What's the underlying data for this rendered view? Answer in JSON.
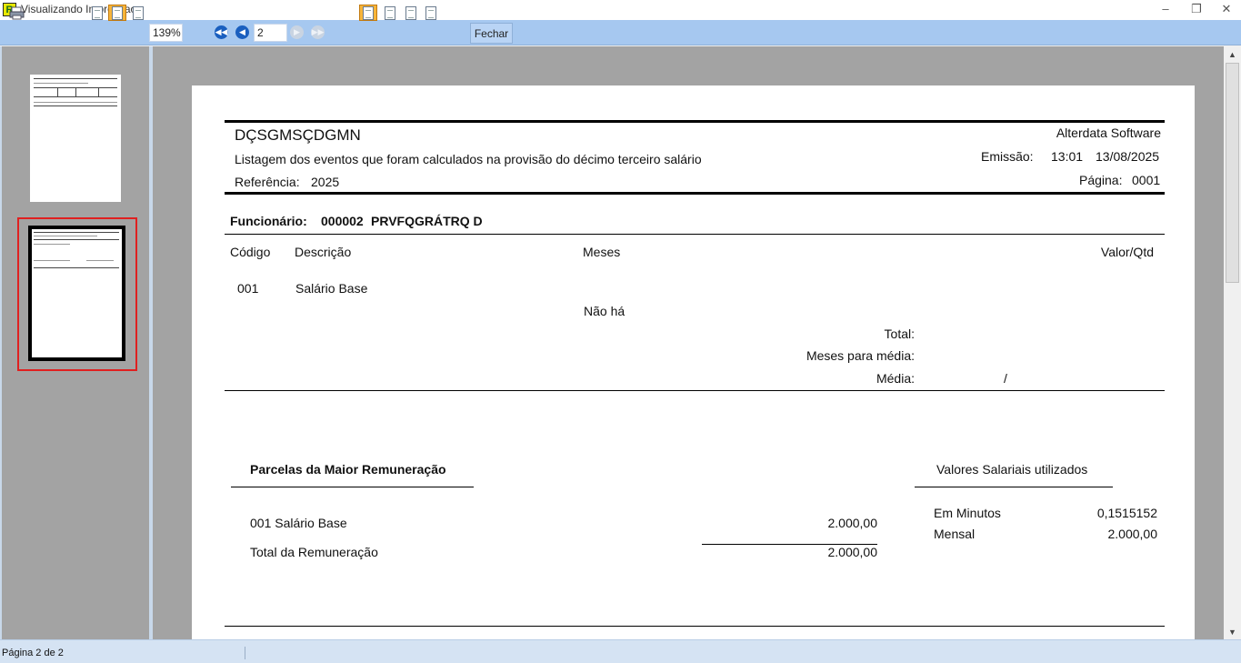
{
  "window": {
    "title": "Visualizando Impressao",
    "app_icon_letter": "R"
  },
  "toolbar": {
    "zoom": "139%",
    "page_number": "2",
    "close_label": "Fechar"
  },
  "report": {
    "company": "DÇSGMSÇDGMN",
    "software": "Alterdata Software",
    "subtitle": "Listagem dos eventos que foram calculados na provisão do décimo terceiro salário",
    "emission_label": "Emissão:",
    "emission_time": "13:01",
    "emission_date": "13/08/2025",
    "reference_label": "Referência:",
    "reference_value": "2025",
    "page_label": "Página:",
    "page_value": "0001",
    "employee_label": "Funcionário:",
    "employee_code": "000002",
    "employee_name": "PRVFQGRÁTRQ D",
    "columns": {
      "code": "Código",
      "description": "Descrição",
      "months": "Meses",
      "value": "Valor/Qtd"
    },
    "event": {
      "code": "001",
      "description": "Salário Base",
      "months_note": "Não há"
    },
    "total_label": "Total:",
    "months_avg_label": "Meses para média:",
    "average_label": "Média:",
    "average_sep": "/",
    "parcels": {
      "title": "Parcelas da Maior Remuneração",
      "item_label": "001 Salário Base",
      "item_value": "2.000,00",
      "total_label": "Total da Remuneração",
      "total_value": "2.000,00"
    },
    "salary_values": {
      "title": "Valores Salariais utilizados",
      "minutes_label": "Em Minutos",
      "minutes_value": "0,1515152",
      "monthly_label": "Mensal",
      "monthly_value": "2.000,00"
    }
  },
  "status": {
    "page_info": "Página 2 de 2"
  }
}
